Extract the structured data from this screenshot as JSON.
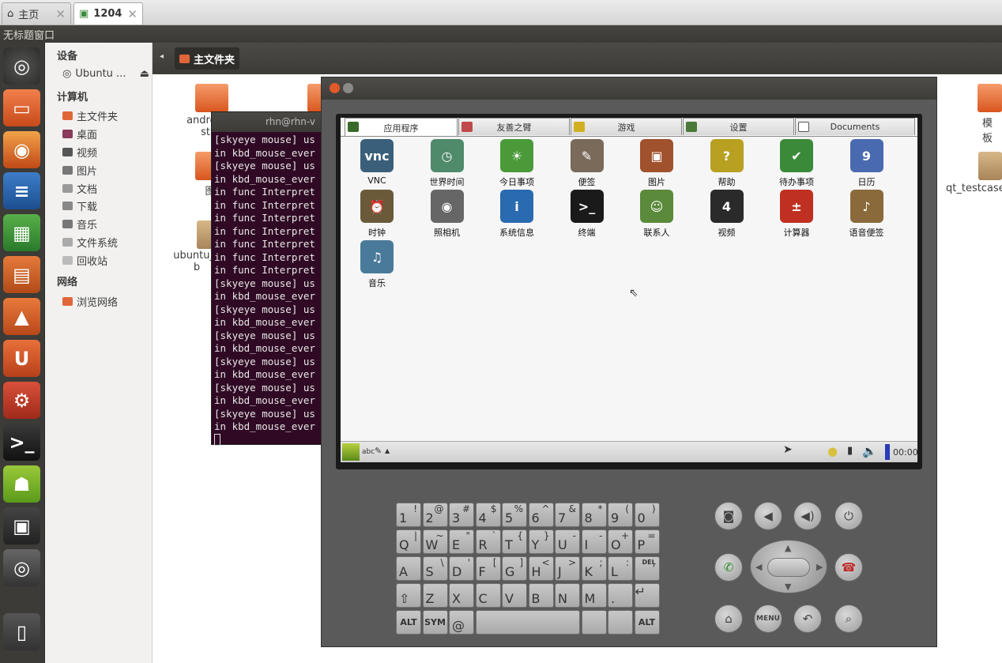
{
  "browser_tabs": [
    {
      "label": "主页"
    },
    {
      "label": "1204"
    }
  ],
  "window_title": "无标题窗口",
  "sidebar": {
    "devices_header": "设备",
    "devices": [
      {
        "label": "Ubuntu ..."
      }
    ],
    "computer_header": "计算机",
    "computer": [
      {
        "label": "主文件夹"
      },
      {
        "label": "桌面"
      },
      {
        "label": "视频"
      },
      {
        "label": "图片"
      },
      {
        "label": "文档"
      },
      {
        "label": "下载"
      },
      {
        "label": "音乐"
      },
      {
        "label": "文件系统"
      },
      {
        "label": "回收站"
      }
    ],
    "network_header": "网络",
    "network": [
      {
        "label": "浏览网络"
      }
    ]
  },
  "breadcrumb": {
    "label": "主文件夹"
  },
  "files": [
    {
      "name": "android_",
      "name2": "sta"
    },
    {
      "name": "图"
    },
    {
      "name": "ubuntu_s",
      "name2": "b"
    },
    {
      "name": "模板"
    },
    {
      "name": "qt_testcase"
    }
  ],
  "terminal": {
    "title": "rhn@rhn-v",
    "lines": [
      "[skyeye mouse] us",
      "in kbd_mouse_ever",
      "[skyeye mouse] us",
      "in kbd_mouse_ever",
      "in func Interpret",
      "in func Interpret",
      "in func Interpret",
      "in func Interpret",
      "in func Interpret",
      "in func Interpret",
      "in func Interpret",
      "[skyeye mouse] us",
      "in kbd_mouse_ever",
      "[skyeye mouse] us",
      "in kbd_mouse_ever",
      "[skyeye mouse] us",
      "in kbd_mouse_ever",
      "[skyeye mouse] us",
      "in kbd_mouse_ever",
      "[skyeye mouse] us",
      "in kbd_mouse_ever",
      "[skyeye mouse] us",
      "in kbd_mouse_ever"
    ]
  },
  "qtopia": {
    "tabs": [
      {
        "label": "应用程序"
      },
      {
        "label": "友善之臂"
      },
      {
        "label": "游戏"
      },
      {
        "label": "设置"
      },
      {
        "label": "Documents"
      }
    ],
    "apps": [
      {
        "label": "VNC",
        "icon": "vnc-icon",
        "glyph": "vnc",
        "color": "#3a5f7a"
      },
      {
        "label": "世界时间",
        "icon": "world-clock-icon",
        "glyph": "◷",
        "color": "#4f8a6a"
      },
      {
        "label": "今日事项",
        "icon": "today-icon",
        "glyph": "☀",
        "color": "#4a9a3a"
      },
      {
        "label": "便签",
        "icon": "notes-icon",
        "glyph": "✎",
        "color": "#7a6a5a"
      },
      {
        "label": "图片",
        "icon": "pictures-icon",
        "glyph": "▣",
        "color": "#a0522d"
      },
      {
        "label": "帮助",
        "icon": "help-icon",
        "glyph": "?",
        "color": "#b8a020"
      },
      {
        "label": "待办事项",
        "icon": "todo-icon",
        "glyph": "✔",
        "color": "#3a8a3a"
      },
      {
        "label": "日历",
        "icon": "calendar-icon",
        "glyph": "9",
        "color": "#4a6ab0"
      },
      {
        "label": "时钟",
        "icon": "clock-icon",
        "glyph": "⏰",
        "color": "#6a5a3a"
      },
      {
        "label": "照相机",
        "icon": "camera-icon",
        "glyph": "◉",
        "color": "#666666"
      },
      {
        "label": "系统信息",
        "icon": "sysinfo-icon",
        "glyph": "i",
        "color": "#2a6ab0"
      },
      {
        "label": "终端",
        "icon": "terminal-icon",
        "glyph": ">_",
        "color": "#1a1a1a"
      },
      {
        "label": "联系人",
        "icon": "contacts-icon",
        "glyph": "☺",
        "color": "#5a8a3a"
      },
      {
        "label": "视频",
        "icon": "video-icon",
        "glyph": "4",
        "color": "#2a2a2a"
      },
      {
        "label": "计算器",
        "icon": "calculator-icon",
        "glyph": "±",
        "color": "#c03020"
      },
      {
        "label": "语音便签",
        "icon": "voice-notes-icon",
        "glyph": "♪",
        "color": "#8a6a3a"
      },
      {
        "label": "音乐",
        "icon": "music-icon",
        "glyph": "♫",
        "color": "#4a7a9a"
      }
    ],
    "taskbar": {
      "input_mode": "abc",
      "clock": "00:00"
    }
  },
  "keyboard": {
    "rows": [
      [
        [
          "1",
          "!"
        ],
        [
          "2",
          "@"
        ],
        [
          "3",
          "#"
        ],
        [
          "4",
          "$"
        ],
        [
          "5",
          "%"
        ],
        [
          "6",
          "^"
        ],
        [
          "7",
          "&"
        ],
        [
          "8",
          "*"
        ],
        [
          "9",
          "("
        ],
        [
          "0",
          ")"
        ]
      ],
      [
        [
          "Q",
          "|"
        ],
        [
          "W",
          "~"
        ],
        [
          "E",
          "\""
        ],
        [
          "R",
          "`"
        ],
        [
          "T",
          "{"
        ],
        [
          "Y",
          "}"
        ],
        [
          "U",
          "-"
        ],
        [
          "I",
          "-"
        ],
        [
          "O",
          "+"
        ],
        [
          "P",
          "="
        ]
      ],
      [
        [
          "A",
          ""
        ],
        [
          "S",
          "\\"
        ],
        [
          "D",
          "'"
        ],
        [
          "F",
          "["
        ],
        [
          "G",
          "]"
        ],
        [
          "H",
          "<"
        ],
        [
          "J",
          ">"
        ],
        [
          "K",
          ";"
        ],
        [
          "L",
          ":"
        ],
        [
          "",
          ","
        ]
      ]
    ],
    "row4": [
      "⇧",
      "Z",
      "X",
      "C",
      "V",
      "B",
      "N",
      "M",
      "."
    ],
    "alt_label": "ALT",
    "sym_label": "SYM",
    "at_label": "@",
    "del_label": "DEL"
  },
  "phone_buttons": {
    "menu_label": "MENU"
  }
}
